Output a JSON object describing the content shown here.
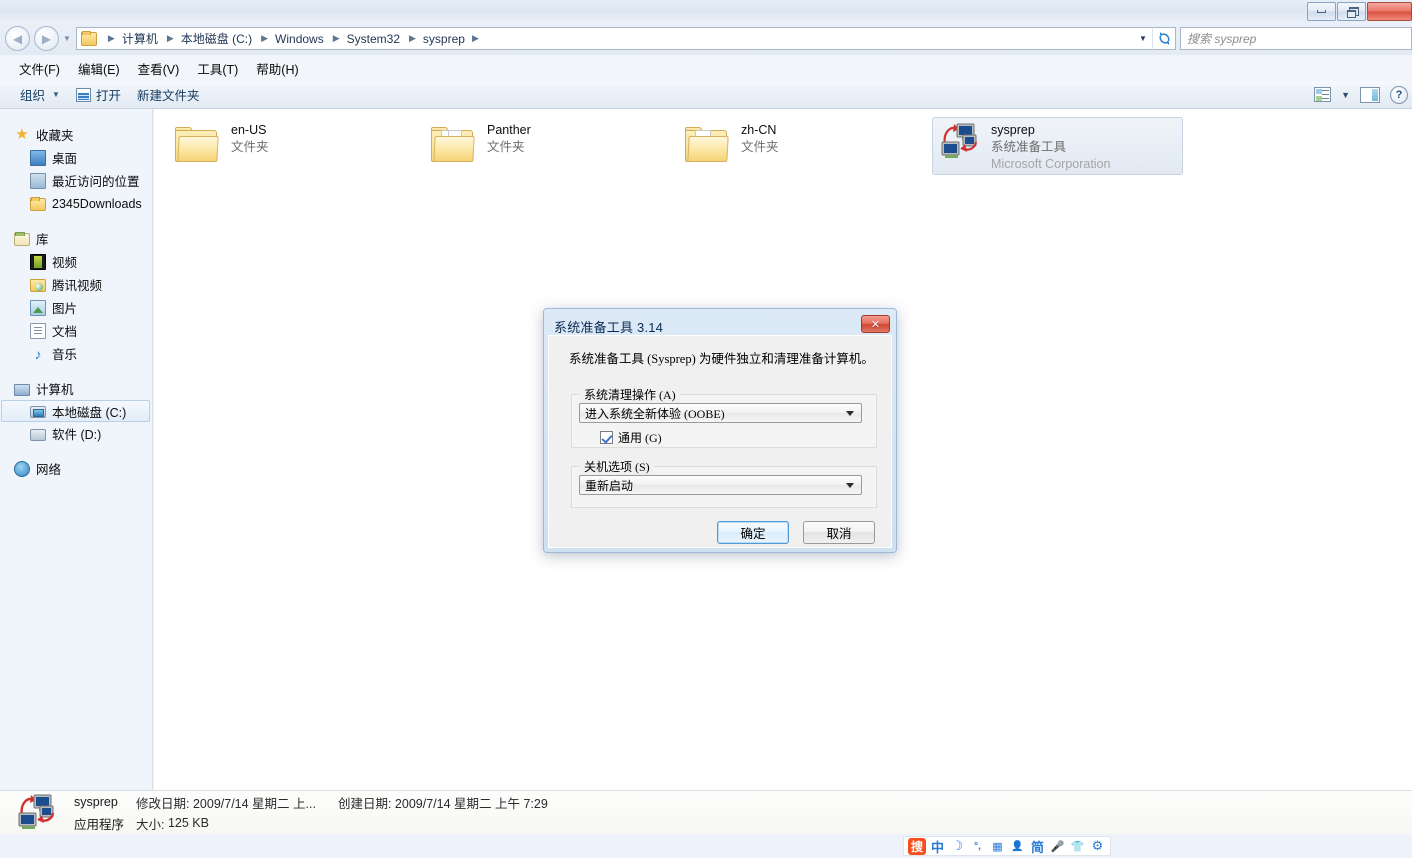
{
  "window": {
    "buttons": {
      "minimize": "minimize-window",
      "maximize": "maximize-window"
    }
  },
  "address_bar": {
    "breadcrumb": [
      "计算机",
      "本地磁盘 (C:)",
      "Windows",
      "System32",
      "sysprep"
    ],
    "separator": "▶",
    "refresh_label": "刷新",
    "search_placeholder": "搜索 sysprep",
    "search_value": ""
  },
  "menubar": {
    "items": [
      "文件(F)",
      "编辑(E)",
      "查看(V)",
      "工具(T)",
      "帮助(H)"
    ]
  },
  "commandbar": {
    "organize": "组织",
    "open": "打开",
    "new_folder": "新建文件夹",
    "help": "?"
  },
  "navpane": {
    "groups": [
      {
        "header": "收藏夹",
        "header_icon": "star-icon",
        "items": [
          {
            "label": "桌面",
            "icon": "desktop-icon"
          },
          {
            "label": "最近访问的位置",
            "icon": "recent-places-icon"
          },
          {
            "label": "2345Downloads",
            "icon": "folder-icon"
          }
        ]
      },
      {
        "header": "库",
        "header_icon": "library-icon",
        "items": [
          {
            "label": "视频",
            "icon": "video-library-icon"
          },
          {
            "label": "腾讯视频",
            "icon": "tencent-video-icon"
          },
          {
            "label": "图片",
            "icon": "pictures-library-icon"
          },
          {
            "label": "文档",
            "icon": "documents-library-icon"
          },
          {
            "label": "音乐",
            "icon": "music-library-icon"
          }
        ]
      },
      {
        "header": "计算机",
        "header_icon": "computer-icon",
        "items": [
          {
            "label": "本地磁盘 (C:)",
            "icon": "local-disk-icon",
            "selected": true
          },
          {
            "label": "软件 (D:)",
            "icon": "drive-icon"
          }
        ]
      },
      {
        "header": "网络",
        "header_icon": "network-icon",
        "items": []
      }
    ]
  },
  "content": {
    "items": [
      {
        "name": "en-US",
        "type": "文件夹",
        "kind": "folder",
        "selected": false
      },
      {
        "name": "Panther",
        "type": "文件夹",
        "kind": "folder",
        "selected": false
      },
      {
        "name": "zh-CN",
        "type": "文件夹",
        "kind": "folder",
        "selected": false
      },
      {
        "name": "sysprep",
        "type": "系统准备工具",
        "publisher": "Microsoft Corporation",
        "kind": "application",
        "selected": true
      }
    ]
  },
  "statusbar": {
    "file_name": "sysprep",
    "file_type": "应用程序",
    "modified_label": "修改日期:",
    "modified_value": "2009/7/14 星期二 上...",
    "created_label": "创建日期:",
    "created_value": "2009/7/14 星期二 上午 7:29",
    "size_label": "大小:",
    "size_value": "125 KB"
  },
  "ime": {
    "items": [
      {
        "name": "sogou-logo-icon",
        "glyph": "搜"
      },
      {
        "name": "chinese-mode-icon",
        "glyph": "中"
      },
      {
        "name": "moon-icon",
        "glyph": "☽"
      },
      {
        "name": "punctuation-icon",
        "glyph": "°,"
      },
      {
        "name": "soft-keyboard-icon",
        "glyph": "▦"
      },
      {
        "name": "user-icon",
        "glyph": "👤"
      },
      {
        "name": "simplified-chinese-icon",
        "glyph": "简"
      },
      {
        "name": "voice-input-icon",
        "glyph": "🎤"
      },
      {
        "name": "skin-icon",
        "glyph": "👕"
      },
      {
        "name": "settings-gear-icon",
        "glyph": "⚙"
      }
    ]
  },
  "dialog": {
    "title": "系统准备工具 3.14",
    "close_label": "✕",
    "description": "系统准备工具 (Sysprep) 为硬件独立和清理准备计算机。",
    "cleanup_group": {
      "label": "系统清理操作 (A)",
      "combo_value": "进入系统全新体验 (OOBE)",
      "checkbox_label": "通用 (G)",
      "checkbox_checked": true
    },
    "shutdown_group": {
      "label": "关机选项 (S)",
      "combo_value": "重新启动"
    },
    "ok_label": "确定",
    "cancel_label": "取消"
  },
  "colors": {
    "accent": "#2a7fd0",
    "dialog_title_bg": "#dce9f6",
    "close_red": "#cf4732",
    "selection": "#e2e9f2",
    "ime_orange": "#f4511e"
  }
}
